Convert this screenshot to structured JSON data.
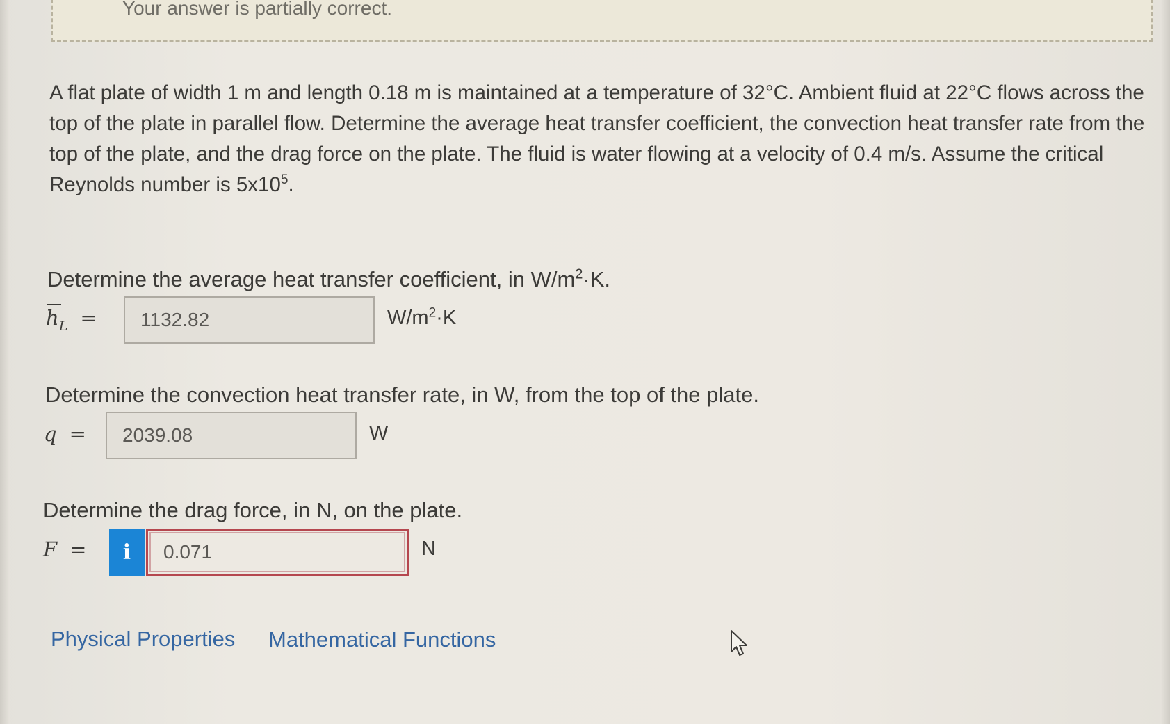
{
  "feedback": {
    "message": "Your answer is partially correct."
  },
  "problem": {
    "text_main": "A flat plate of width 1 m and length 0.18 m is maintained at a temperature of 32°C. Ambient fluid at 22°C flows across the top of the plate in parallel flow. Determine the average heat transfer coefficient, the convection heat transfer rate from the top of the plate, and the drag force on the plate. The fluid is water flowing at a velocity of 0.4 m/s. Assume the critical Reynolds number is 5x10",
    "exponent": "5",
    "end": "."
  },
  "questions": [
    {
      "prompt_pre": "Determine the average heat transfer coefficient, in W/m",
      "prompt_sup": "2",
      "prompt_post": "·K.",
      "symbol": "h",
      "symbol_sub": "L",
      "equals": "=",
      "value": "1132.82",
      "unit_pre": "W/m",
      "unit_sup": "2",
      "unit_post": "·K",
      "status": "correct"
    },
    {
      "prompt": "Determine the convection heat transfer rate, in W, from the top of the plate.",
      "symbol": "q",
      "equals": "=",
      "value": "2039.08",
      "unit": "W",
      "status": "correct"
    },
    {
      "prompt": "Determine the drag force, in N, on the plate.",
      "symbol": "F",
      "equals": "=",
      "info_label": "i",
      "value": "0.071",
      "unit": "N",
      "status": "incorrect"
    }
  ],
  "links": {
    "physical_properties": "Physical Properties",
    "mathematical_functions": "Mathematical Functions"
  },
  "colors": {
    "link": "#3566a2",
    "info_button": "#1b85d6",
    "incorrect_border": "#b5474f"
  },
  "icons": {
    "info": "info-icon",
    "cursor": "mouse-pointer-icon"
  }
}
